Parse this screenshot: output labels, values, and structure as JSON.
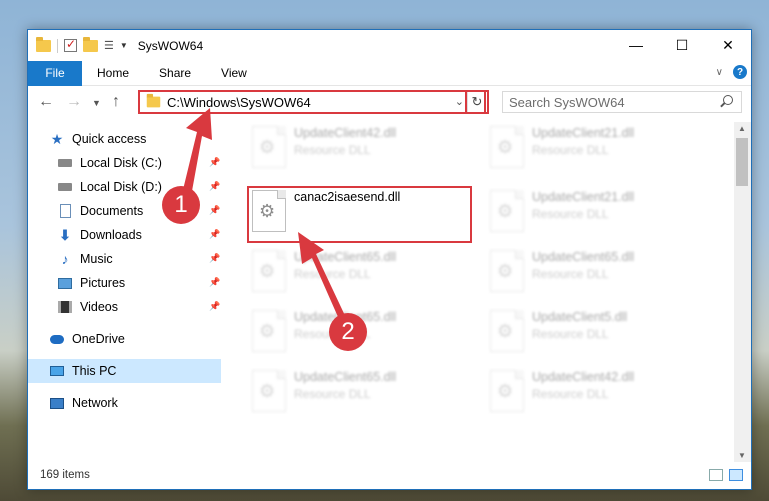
{
  "window": {
    "title": "SysWOW64"
  },
  "ribbon": {
    "tabs": [
      "File",
      "Home",
      "Share",
      "View"
    ]
  },
  "address": {
    "path": "C:\\Windows\\SysWOW64"
  },
  "search": {
    "placeholder": "Search SysWOW64"
  },
  "sidebar": {
    "items": [
      {
        "label": "Quick access"
      },
      {
        "label": "Local Disk (C:)"
      },
      {
        "label": "Local Disk (D:)"
      },
      {
        "label": "Documents"
      },
      {
        "label": "Downloads"
      },
      {
        "label": "Music"
      },
      {
        "label": "Pictures"
      },
      {
        "label": "Videos"
      },
      {
        "label": "OneDrive"
      },
      {
        "label": "This PC"
      },
      {
        "label": "Network"
      }
    ]
  },
  "files": [
    {
      "name": "UpdateClient42.dll",
      "type": "Resource DLL"
    },
    {
      "name": "UpdateClient21.dll",
      "type": "Resource DLL"
    },
    {
      "name": "canac2isaesend.dll",
      "type": ""
    },
    {
      "name": "UpdateClient21.dll",
      "type": "Resource DLL"
    },
    {
      "name": "UpdateClient65.dll",
      "type": "Resource DLL"
    },
    {
      "name": "UpdateClient65.dll",
      "type": "Resource DLL"
    },
    {
      "name": "UpdateClient65.dll",
      "type": "Resource DLL"
    },
    {
      "name": "UpdateClient5.dll",
      "type": "Resource DLL"
    },
    {
      "name": "UpdateClient65.dll",
      "type": "Resource DLL"
    },
    {
      "name": "UpdateClient42.dll",
      "type": "Resource DLL"
    }
  ],
  "status": {
    "count": "169 items"
  },
  "annotations": {
    "badge1": "1",
    "badge2": "2"
  },
  "colors": {
    "accent": "#1979ca",
    "highlight": "#d9393f",
    "selected": "#cce8ff"
  }
}
